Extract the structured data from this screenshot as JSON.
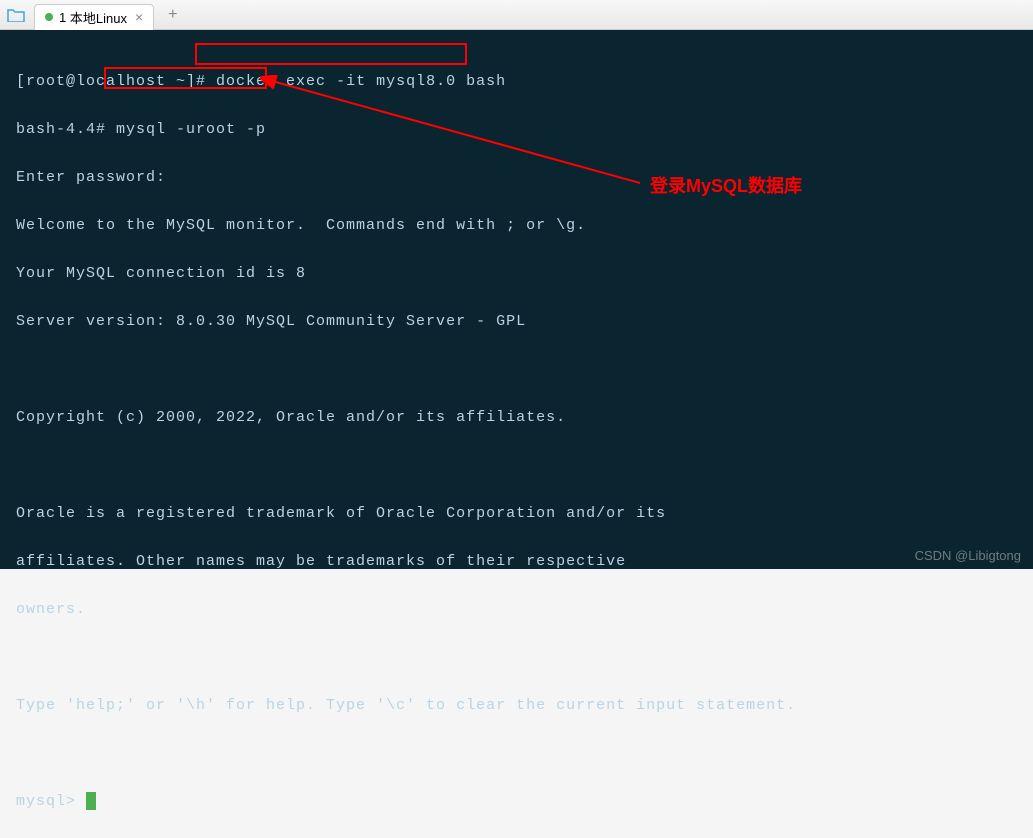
{
  "tab": {
    "index": "1",
    "title": "本地Linux"
  },
  "terminal": {
    "prompt1_user": "[root@localhost ~]#",
    "cmd1": "docker exec -it mysql8.0 bash",
    "prompt2": "bash-4.4#",
    "cmd2": "mysql -uroot -p",
    "line3": "Enter password:",
    "line4": "Welcome to the MySQL monitor.  Commands end with ; or \\g.",
    "line5": "Your MySQL connection id is 8",
    "line6": "Server version: 8.0.30 MySQL Community Server - GPL",
    "line8": "Copyright (c) 2000, 2022, Oracle and/or its affiliates.",
    "line10": "Oracle is a registered trademark of Oracle Corporation and/or its",
    "line11": "affiliates. Other names may be trademarks of their respective",
    "line12": "owners.",
    "line14": "Type 'help;' or '\\h' for help. Type '\\c' to clear the current input statement.",
    "prompt3": "mysql>"
  },
  "annotation": {
    "label": "登录MySQL数据库"
  },
  "watermark": "CSDN @Libigtong"
}
